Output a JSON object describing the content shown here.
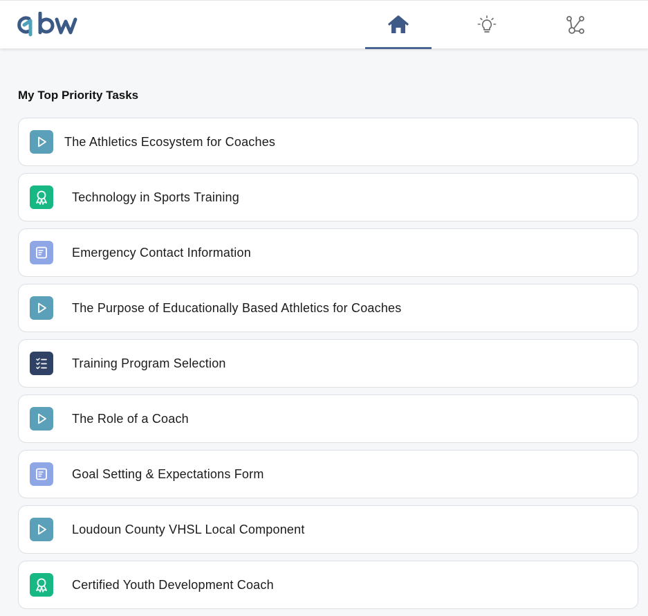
{
  "header": {
    "logo_text": "gbw",
    "nav": [
      {
        "name": "home",
        "icon": "home-icon",
        "active": true
      },
      {
        "name": "ideas",
        "icon": "lightbulb-icon",
        "active": false
      },
      {
        "name": "network",
        "icon": "network-icon",
        "active": false
      }
    ]
  },
  "colors": {
    "accent": "#4a6591",
    "video": "#5aa0b8",
    "certificate": "#18b885",
    "form": "#8fa6e6",
    "checklist": "#2f4266"
  },
  "main": {
    "title": "My Top Priority Tasks",
    "tasks": [
      {
        "label": "The Athletics Ecosystem for Coaches",
        "type": "video",
        "icon": "play-icon"
      },
      {
        "label": "Technology in Sports Training",
        "type": "certificate",
        "icon": "award-ribbon-icon"
      },
      {
        "label": "Emergency Contact Information",
        "type": "form",
        "icon": "form-icon"
      },
      {
        "label": "The Purpose of Educationally Based Athletics for Coaches",
        "type": "video",
        "icon": "play-icon"
      },
      {
        "label": "Training Program Selection",
        "type": "checklist",
        "icon": "checklist-icon"
      },
      {
        "label": "The Role of a Coach",
        "type": "video",
        "icon": "play-icon"
      },
      {
        "label": "Goal Setting & Expectations Form",
        "type": "form",
        "icon": "form-icon"
      },
      {
        "label": "Loudoun County VHSL Local Component",
        "type": "video",
        "icon": "play-icon"
      },
      {
        "label": "Certified Youth Development Coach",
        "type": "certificate",
        "icon": "award-ribbon-icon"
      }
    ]
  }
}
